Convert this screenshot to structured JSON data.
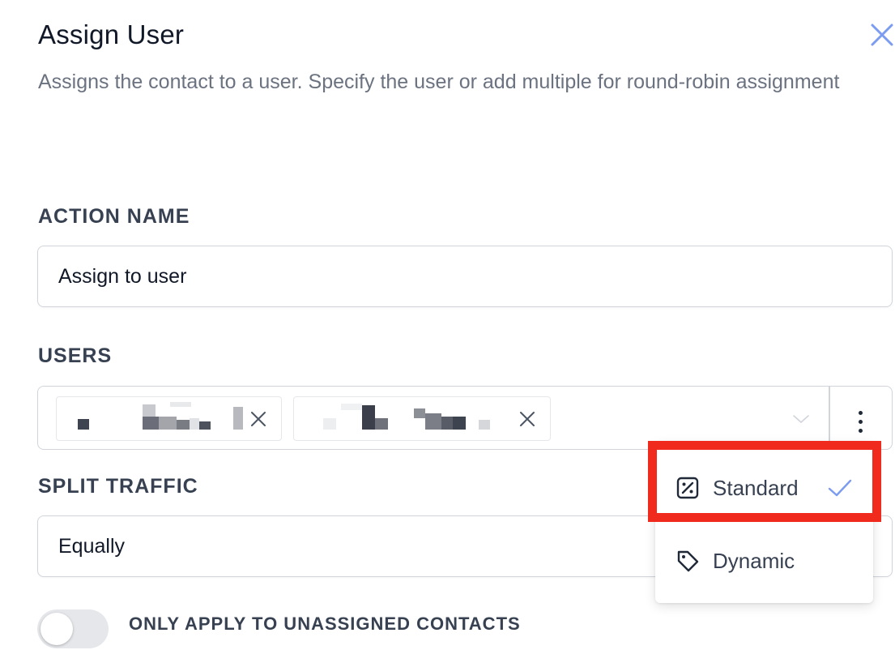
{
  "panel": {
    "title": "Assign User",
    "subtitle": "Assigns the contact to a user. Specify the user or add multiple for round-robin assignment",
    "close_icon": "close-icon"
  },
  "action_name": {
    "label": "ACTION NAME",
    "value": "Assign to user"
  },
  "users": {
    "label": "USERS",
    "chips": [
      {
        "name": "",
        "redacted": true,
        "remove_icon": "close-icon"
      },
      {
        "name": "",
        "redacted": true,
        "remove_icon": "close-icon"
      }
    ],
    "dropdown_icon": "chevron-down-icon",
    "more_icon": "vertical-dots-icon"
  },
  "split_traffic": {
    "label": "SPLIT TRAFFIC",
    "value": "Equally"
  },
  "mode_menu": {
    "items": [
      {
        "label": "Standard",
        "icon": "percentage-square-icon",
        "selected": true
      },
      {
        "label": "Dynamic",
        "icon": "tag-icon",
        "selected": false
      }
    ],
    "check_icon": "check-icon"
  },
  "unassigned_toggle": {
    "label": "ONLY APPLY TO UNASSIGNED CONTACTS",
    "enabled": false
  },
  "colors": {
    "accent": "#7c9cf0",
    "highlight": "#f02a1c",
    "label": "#374151",
    "muted": "#6b7280"
  }
}
